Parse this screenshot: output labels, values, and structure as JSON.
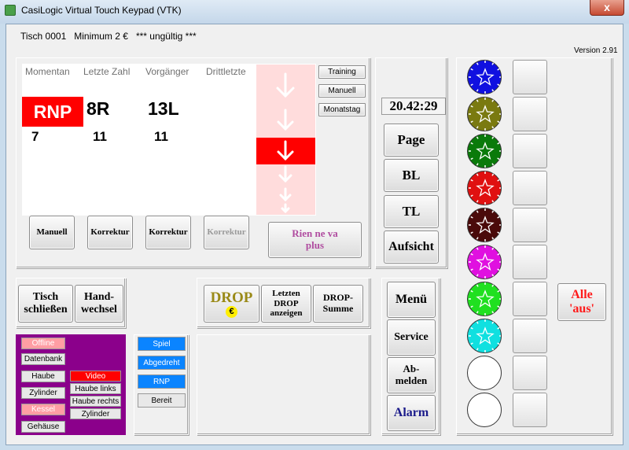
{
  "window": {
    "title": "CasiLogic Virtual Touch Keypad (VTK)",
    "close": "x"
  },
  "info": {
    "line": "Tisch 0001   Minimum 2 €   *** ungültig ***",
    "version": "Version 2.91"
  },
  "results": {
    "headers": [
      "Momentan",
      "Letzte Zahl",
      "Vorgänger",
      "Drittletzte"
    ],
    "current": "RNP",
    "last": "8R",
    "previous": "13L",
    "row2": [
      "7",
      "11",
      "11"
    ]
  },
  "mode_buttons": [
    "Training",
    "Manuell",
    "Monatstag"
  ],
  "bottom_buttons": [
    "Manuell",
    "Korrektur",
    "Korrektur",
    "Korrektur"
  ],
  "rien_ne_va_plus": "Rien ne va plus",
  "clock": "20.42:29",
  "right_buttons": [
    "Page",
    "BL",
    "TL",
    "Aufsicht"
  ],
  "table_buttons": {
    "close": "Tisch schließen",
    "change": "Hand-wechsel"
  },
  "drop": {
    "label": "DROP",
    "currency": "€",
    "last": "Letzten DROP anzeigen",
    "sum": "DROP-Summe"
  },
  "menu_buttons": [
    "Menü",
    "Service",
    "Ab-melden",
    "Alarm"
  ],
  "status": {
    "left": [
      "Offline",
      "Datenbank",
      "Haube",
      "Zylinder",
      "Kessel",
      "Gehäuse"
    ],
    "right": [
      "Video",
      "Haube links",
      "Haube rechts",
      "Zylinder"
    ]
  },
  "game_states": [
    "Spiel",
    "Abgedreht",
    "RNP",
    "Bereit"
  ],
  "chips": [
    "#1010e0",
    "#7a7a10",
    "#0a7a0a",
    "#e01010",
    "#4a0a0a",
    "#e010e0",
    "#20e020",
    "#10e0e0",
    "#ffffff",
    "#ffffff"
  ],
  "all_off": "Alle 'aus'",
  "colors": {
    "red": "#ff0000",
    "purple": "#8b008b",
    "blue_btn": "#0a84ff",
    "rnp_pink": "#ff9ea4"
  }
}
